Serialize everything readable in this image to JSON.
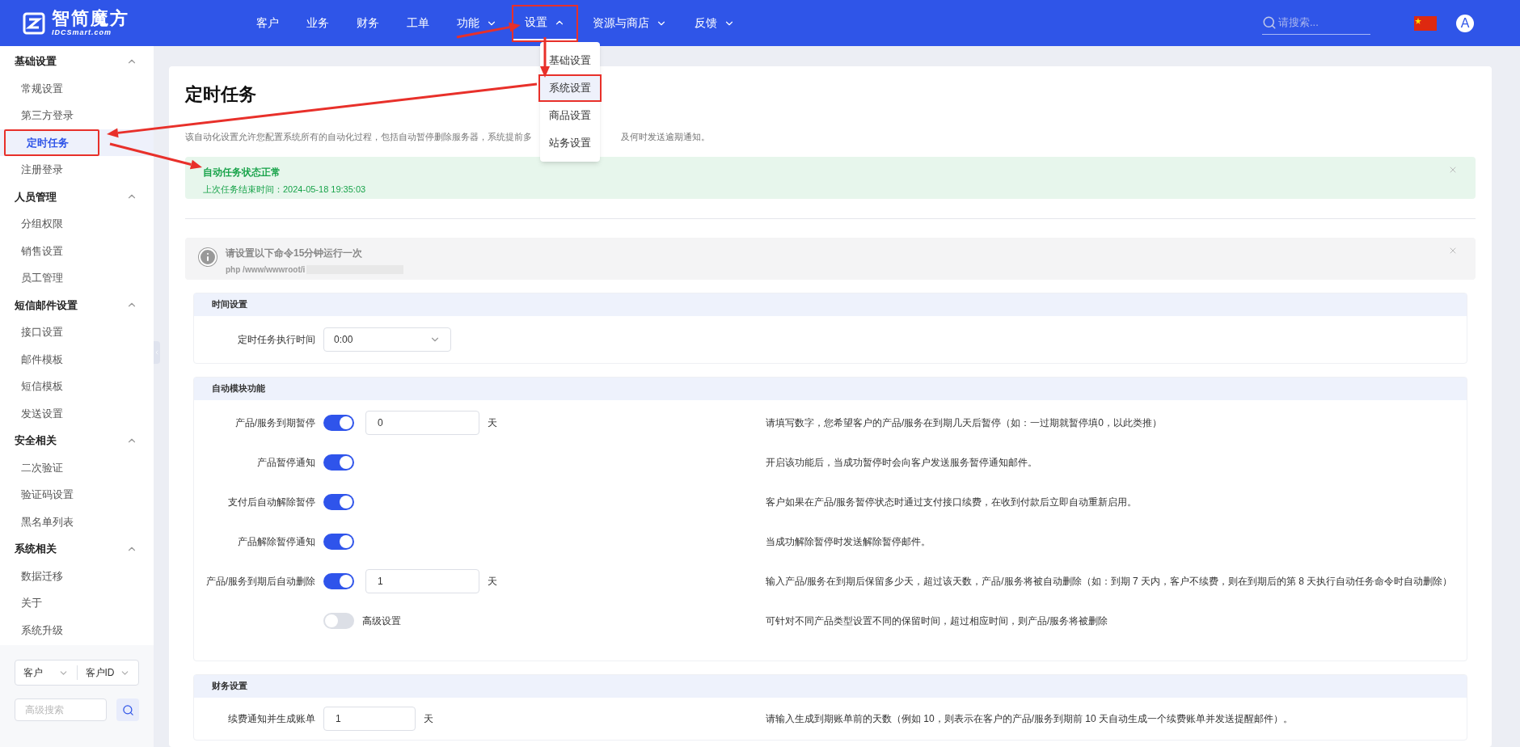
{
  "logo": {
    "name": "智简魔方",
    "subtitle": "IDCSmart.com"
  },
  "nav": [
    {
      "label": "客户",
      "has_menu": false,
      "selected": false,
      "annotated": false
    },
    {
      "label": "业务",
      "has_menu": false,
      "selected": false,
      "annotated": false
    },
    {
      "label": "财务",
      "has_menu": false,
      "selected": false,
      "annotated": false
    },
    {
      "label": "工单",
      "has_menu": false,
      "selected": false,
      "annotated": false
    },
    {
      "label": "功能",
      "has_menu": true,
      "selected": false,
      "annotated": false
    },
    {
      "label": "设置",
      "has_menu": true,
      "selected": true,
      "annotated": true
    },
    {
      "label": "资源与商店",
      "has_menu": true,
      "selected": false,
      "annotated": false
    },
    {
      "label": "反馈",
      "has_menu": true,
      "selected": false,
      "annotated": false
    }
  ],
  "nav_menu": [
    {
      "label": "基础设置",
      "annotated": false
    },
    {
      "label": "系统设置",
      "annotated": true
    },
    {
      "label": "商品设置",
      "annotated": false
    },
    {
      "label": "站务设置",
      "annotated": false
    }
  ],
  "search": {
    "placeholder": "请搜索..."
  },
  "avatar": "A",
  "sidebar": {
    "groups": [
      {
        "title": "基础设置",
        "expanded": true,
        "items": [
          {
            "label": "常规设置",
            "selected": false,
            "annotated": false
          },
          {
            "label": "第三方登录",
            "selected": false,
            "annotated": false
          },
          {
            "label": "定时任务",
            "selected": true,
            "annotated": true
          },
          {
            "label": "注册登录",
            "selected": false,
            "annotated": false
          }
        ]
      },
      {
        "title": "人员管理",
        "expanded": true,
        "items": [
          {
            "label": "分组权限",
            "selected": false,
            "annotated": false
          },
          {
            "label": "销售设置",
            "selected": false,
            "annotated": false
          },
          {
            "label": "员工管理",
            "selected": false,
            "annotated": false
          }
        ]
      },
      {
        "title": "短信邮件设置",
        "expanded": true,
        "items": [
          {
            "label": "接口设置",
            "selected": false,
            "annotated": false
          },
          {
            "label": "邮件模板",
            "selected": false,
            "annotated": false
          },
          {
            "label": "短信模板",
            "selected": false,
            "annotated": false
          },
          {
            "label": "发送设置",
            "selected": false,
            "annotated": false
          }
        ]
      },
      {
        "title": "安全相关",
        "expanded": true,
        "items": [
          {
            "label": "二次验证",
            "selected": false,
            "annotated": false
          },
          {
            "label": "验证码设置",
            "selected": false,
            "annotated": false
          },
          {
            "label": "黑名单列表",
            "selected": false,
            "annotated": false
          }
        ]
      },
      {
        "title": "系统相关",
        "expanded": true,
        "items": [
          {
            "label": "数据迁移",
            "selected": false,
            "annotated": false
          },
          {
            "label": "关于",
            "selected": false,
            "annotated": false
          },
          {
            "label": "系统升级",
            "selected": false,
            "annotated": false
          }
        ]
      }
    ],
    "filters": {
      "type": "客户",
      "field": "客户ID",
      "search_placeholder": "高级搜索"
    }
  },
  "page": {
    "title": "定时任务",
    "description_start": "该自动化设置允许您配置系统所有的自动化过程，包括自动暂停删除服务器，系统提前多",
    "description_end": "及何时发送逾期通知。",
    "status": {
      "title": "自动任务状态正常",
      "detail": "上次任务结束时间：2024-05-18 19:35:03"
    },
    "cron": {
      "title": "请设置以下命令15分钟运行一次",
      "command": "php /www/wwwroot/i"
    },
    "sections": [
      {
        "title": "时间设置",
        "rows": [
          {
            "kind": "select",
            "label": "定时任务执行时间",
            "value": "0:00"
          }
        ]
      },
      {
        "title": "自动模块功能",
        "rows": [
          {
            "kind": "switch",
            "label": "产品/服务到期暂停",
            "on": true,
            "value": "0",
            "unit": "天",
            "help": "请填写数字，您希望客户的产品/服务在到期几天后暂停（如：一过期就暂停填0，以此类推）"
          },
          {
            "kind": "switch",
            "label": "产品暂停通知",
            "on": true,
            "help": "开启该功能后，当成功暂停时会向客户发送服务暂停通知邮件。"
          },
          {
            "kind": "switch",
            "label": "支付后自动解除暂停",
            "on": true,
            "help": "客户如果在产品/服务暂停状态时通过支付接口续费，在收到付款后立即自动重新启用。"
          },
          {
            "kind": "switch",
            "label": "产品解除暂停通知",
            "on": true,
            "help": "当成功解除暂停时发送解除暂停邮件。"
          },
          {
            "kind": "switch",
            "label": "产品/服务到期后自动删除",
            "on": true,
            "value": "1",
            "unit": "天",
            "help": "输入产品/服务在到期后保留多少天，超过该天数，产品/服务将被自动删除（如：到期 7 天内，客户不续费，则在到期后的第 8 天执行自动任务命令时自动删除）"
          },
          {
            "kind": "switch",
            "switch_label": "高级设置",
            "on": false,
            "help": "可针对不同产品类型设置不同的保留时间，超过相应时间，则产品/服务将被删除"
          }
        ]
      },
      {
        "title": "财务设置",
        "rows": [
          {
            "kind": "input",
            "label": "续费通知并生成账单",
            "value": "1",
            "unit": "天",
            "help": "请输入生成到期账单前的天数（例如 10，则表示在客户的产品/服务到期前 10 天自动生成一个续费账单并发送提醒邮件）。"
          }
        ]
      }
    ]
  }
}
